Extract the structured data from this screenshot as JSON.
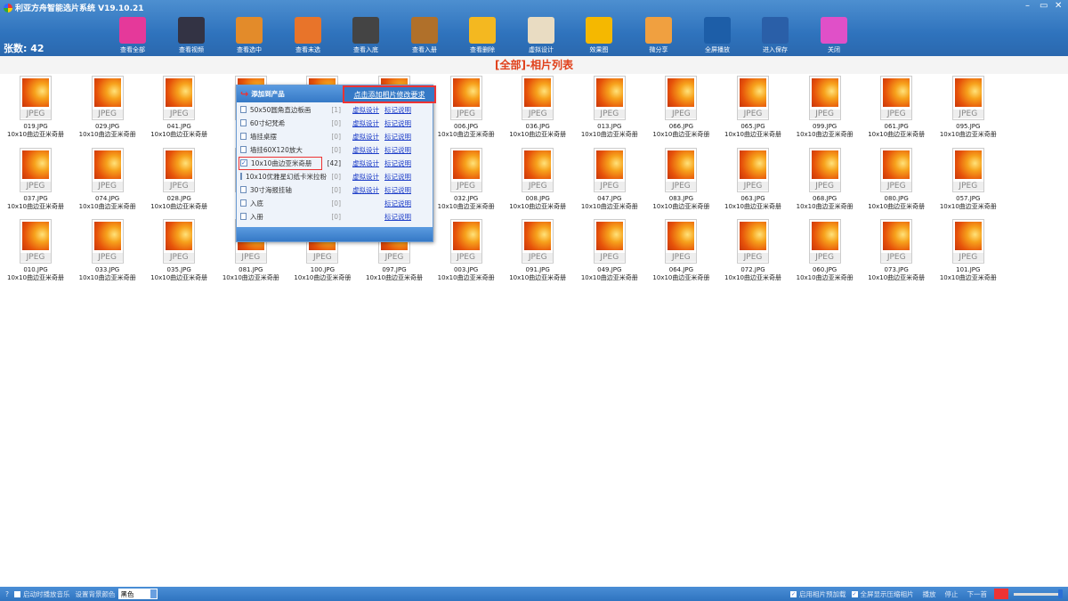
{
  "window": {
    "title": "利亚方舟智能选片系统 V19.10.21",
    "minimize": "–",
    "restore": "▭",
    "close": "✕"
  },
  "count_label": "张数:  42",
  "toolbar": [
    {
      "label": "查看全部",
      "icon": "calendar-icon",
      "color": "#e5399a"
    },
    {
      "label": "查看视频",
      "icon": "film-icon",
      "color": "#334"
    },
    {
      "label": "查看选中",
      "icon": "picture-icon",
      "color": "#e38b2a"
    },
    {
      "label": "查看未选",
      "icon": "folder-search-icon",
      "color": "#e8742a"
    },
    {
      "label": "查看入底",
      "icon": "film-star-icon",
      "color": "#444"
    },
    {
      "label": "查看入册",
      "icon": "album-icon",
      "color": "#b0702a"
    },
    {
      "label": "查看删除",
      "icon": "folder-delete-icon",
      "color": "#f4b820"
    },
    {
      "label": "虚拟设计",
      "icon": "design-icon",
      "color": "#e9dcc2"
    },
    {
      "label": "效果图",
      "icon": "puzzle-icon",
      "color": "#f5b800"
    },
    {
      "label": "微分享",
      "icon": "aperture-icon",
      "color": "#f0a040"
    },
    {
      "label": "全屏播放",
      "icon": "fullscreen-icon",
      "color": "#1d5ea8"
    },
    {
      "label": "进入保存",
      "icon": "save-icon",
      "color": "#2a5fa8"
    },
    {
      "label": "关闭",
      "icon": "exit-door-icon",
      "color": "#e050c8"
    }
  ],
  "list_title": "[全部]-相片列表",
  "photo_caption": "10x10曲边亚米奇册",
  "photo_type": "JPEG",
  "photos": [
    [
      "019.JPG",
      "029.JPG",
      "041.JPG",
      null,
      null,
      null,
      "006.JPG",
      "036.JPG",
      "013.JPG",
      "066.JPG",
      "065.JPG",
      "099.JPG",
      "061.JPG",
      "095.JPG"
    ],
    [
      "037.JPG",
      "074.JPG",
      "028.JPG",
      null,
      null,
      null,
      "032.JPG",
      "008.JPG",
      "047.JPG",
      "083.JPG",
      "063.JPG",
      "068.JPG",
      "080.JPG",
      "057.JPG"
    ],
    [
      "010.JPG",
      "033.JPG",
      "035.JPG",
      "081.JPG",
      "100.JPG",
      "097.JPG",
      "003.JPG",
      "091.JPG",
      "049.JPG",
      "064.JPG",
      "072.JPG",
      "060.JPG",
      "073.JPG",
      "101.JPG"
    ]
  ],
  "popup": {
    "title": "添加到产品",
    "add_link": "点击添加相片修改要求",
    "design_link": "虚拟设计",
    "note_link": "标记说明",
    "products": [
      {
        "name": "50x50圆角直边板画",
        "count": "[1]",
        "checked": false,
        "design": true
      },
      {
        "name": "60寸纪梵希",
        "count": "[0]",
        "checked": false,
        "design": true
      },
      {
        "name": "墙挂桌摆",
        "count": "[0]",
        "checked": false,
        "design": true
      },
      {
        "name": "墙挂60X120放大",
        "count": "[0]",
        "checked": false,
        "design": true
      },
      {
        "name": "10x10曲边亚米奇册",
        "count": "[42]",
        "checked": true,
        "design": true
      },
      {
        "name": "10x10优雅星幻纸卡米拉粉",
        "count": "[0]",
        "checked": false,
        "design": true
      },
      {
        "name": "30寸海报挂轴",
        "count": "[0]",
        "checked": false,
        "design": true
      },
      {
        "name": "入底",
        "count": "[0]",
        "checked": false,
        "design": false
      },
      {
        "name": "入册",
        "count": "[0]",
        "checked": false,
        "design": false
      }
    ]
  },
  "statusbar": {
    "help": "?",
    "play_music_label": "启动时播放音乐",
    "play_music_checked": false,
    "bg_color_label": "设置背景颜色",
    "bg_color_value": "黑色",
    "preload_label": "启用相片预加载",
    "preload_checked": true,
    "fullscreen_compressed_label": "全屏显示压缩相片",
    "fullscreen_compressed_checked": true,
    "play": "播放",
    "stop": "停止",
    "next": "下一首",
    "volume_percent": 100
  }
}
